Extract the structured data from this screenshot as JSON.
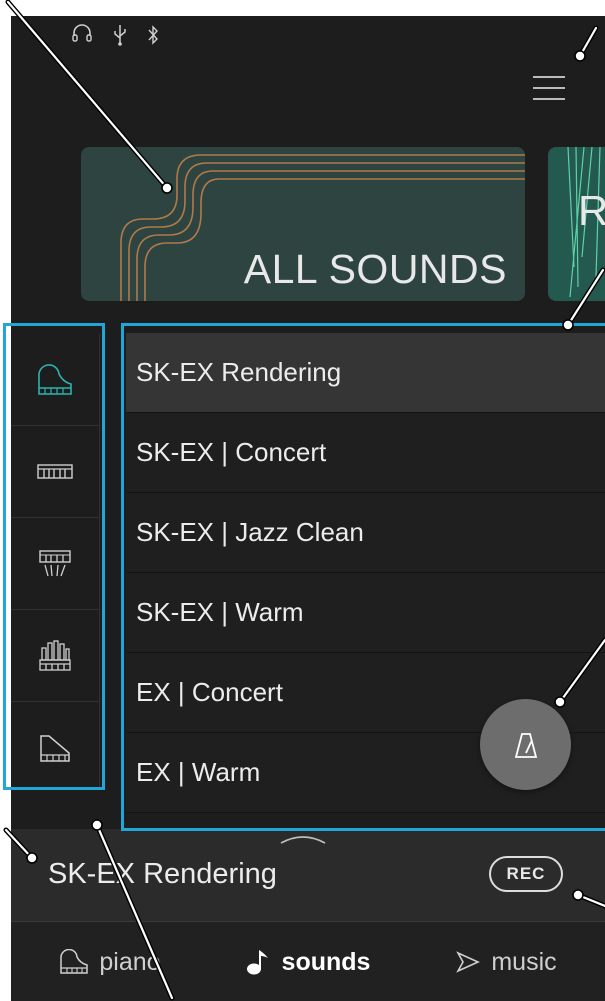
{
  "colors": {
    "accent": "#22a6d9",
    "background": "#1d1d1d",
    "selected_row": "#353535",
    "instrument_highlight": "#2bb3b0"
  },
  "status_icons": [
    "headphones-icon",
    "usb-icon",
    "bluetooth-icon"
  ],
  "header": {
    "menu_icon": "hamburger-menu-icon"
  },
  "cards": [
    {
      "label": "ALL SOUNDS",
      "active": true
    },
    {
      "label": "R",
      "active": false
    }
  ],
  "categories": [
    {
      "name": "grand-piano-icon",
      "selected": true
    },
    {
      "name": "electric-piano-icon",
      "selected": false
    },
    {
      "name": "harpsichord-icon",
      "selected": false
    },
    {
      "name": "organ-icon",
      "selected": false
    },
    {
      "name": "upright-piano-icon",
      "selected": false
    }
  ],
  "sounds": [
    {
      "label": "SK-EX Rendering",
      "selected": true
    },
    {
      "label": "SK-EX | Concert",
      "selected": false
    },
    {
      "label": "SK-EX | Jazz Clean",
      "selected": false
    },
    {
      "label": "SK-EX | Warm",
      "selected": false
    },
    {
      "label": "EX | Concert",
      "selected": false
    },
    {
      "label": "EX | Warm",
      "selected": false
    }
  ],
  "metronome": {
    "icon": "metronome-icon"
  },
  "now_playing": {
    "title": "SK-EX Rendering",
    "rec_label": "REC"
  },
  "tabs": [
    {
      "label": "piano",
      "icon": "piano-icon",
      "active": false
    },
    {
      "label": "sounds",
      "icon": "music-note-icon",
      "active": true
    },
    {
      "label": "music",
      "icon": "play-icon",
      "active": false
    }
  ]
}
